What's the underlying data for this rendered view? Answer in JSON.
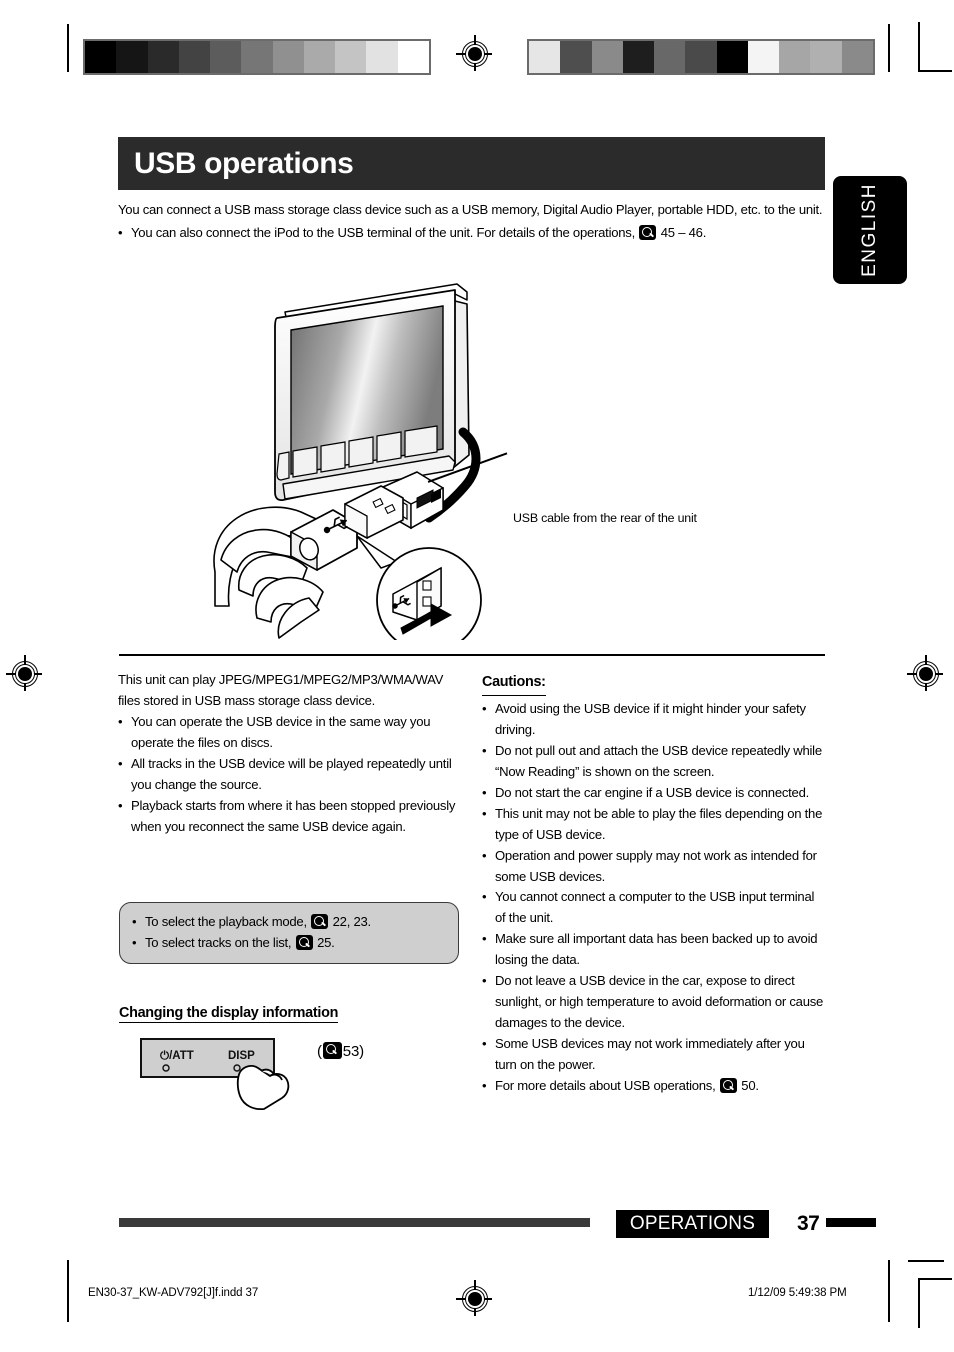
{
  "meta": {
    "language_tab": "ENGLISH"
  },
  "header": {
    "title": "USB operations"
  },
  "intro": {
    "paragraph": "You can connect a USB mass storage class device such as a USB memory, Digital Audio Player, portable HDD, etc. to the unit.",
    "bullet_prefix": "You can also connect the iPod to the USB terminal of the unit. For details of the operations,",
    "bullet_pages": "45 – 46."
  },
  "illustration": {
    "caption": "USB cable from the rear of the unit",
    "alt": "Car head unit with USB cable, hand inserting a USB memory stick, detail circle showing plug orientation"
  },
  "left_column": {
    "intro_paragraph": "This unit can play JPEG/MPEG1/MPEG2/MP3/WMA/WAV files stored in USB mass storage class device.",
    "bullets": [
      "You can operate the USB device in the same way you operate the files on discs.",
      "All tracks in the USB device will be played repeatedly until you change the source.",
      "Playback starts from where it has been stopped previously when you reconnect the same USB device again."
    ],
    "callout": [
      {
        "text": "To select the playback mode,",
        "pages": "22, 23."
      },
      {
        "text": "To select tracks on the list,",
        "pages": "25."
      }
    ],
    "subhead": "Changing the display information",
    "panel": {
      "left_label": "⏻/ATT",
      "right_label": "DISP"
    },
    "panel_ref_open": "(",
    "panel_ref_page": "53)"
  },
  "right_column": {
    "heading": "Cautions:",
    "bullets": [
      "Avoid using the USB device if it might hinder your safety driving.",
      "Do not pull out and attach the USB device repeatedly while “Now Reading” is shown on the screen.",
      "Do not start the car engine if a USB device is connected.",
      "This unit may not be able to play the files depending on the type of USB device.",
      "Operation and power supply may not work as intended for some USB devices.",
      "You cannot connect a computer to the USB input terminal of the unit.",
      "Make sure all important data has been backed up to avoid losing the data.",
      "Do not leave a USB device in the car, expose to direct sunlight, or high temperature to avoid deformation or cause damages to the device.",
      "Some USB devices may not work immediately after you turn on the power."
    ],
    "last_bullet": {
      "text": "For more details about USB operations,",
      "pages": "50."
    }
  },
  "footer": {
    "section_label": "OPERATIONS",
    "page_number": "37"
  },
  "imprint": {
    "file": "EN30-37_KW-ADV792[J]f.indd   37",
    "date": "1/12/09   5:49:38 PM"
  },
  "color_bars": {
    "left": [
      "#000000",
      "#151515",
      "#2a2a2a",
      "#434343",
      "#5c5c5c",
      "#767676",
      "#909090",
      "#aaaaaa",
      "#c4c4c4",
      "#e2e2e2",
      "#ffffff"
    ],
    "right": [
      "#e6e6e6",
      "#4e4e4e",
      "#8a8a8a",
      "#1e1e1e",
      "#686868",
      "#4a4a4a",
      "#000000",
      "#f4f4f4",
      "#a6a6a6",
      "#b0b0b0",
      "#8a8a8a"
    ]
  },
  "bullet_glyph": "•",
  "icons": {
    "page_ref": "magnifier-icon",
    "registration": "registration-mark-icon"
  }
}
